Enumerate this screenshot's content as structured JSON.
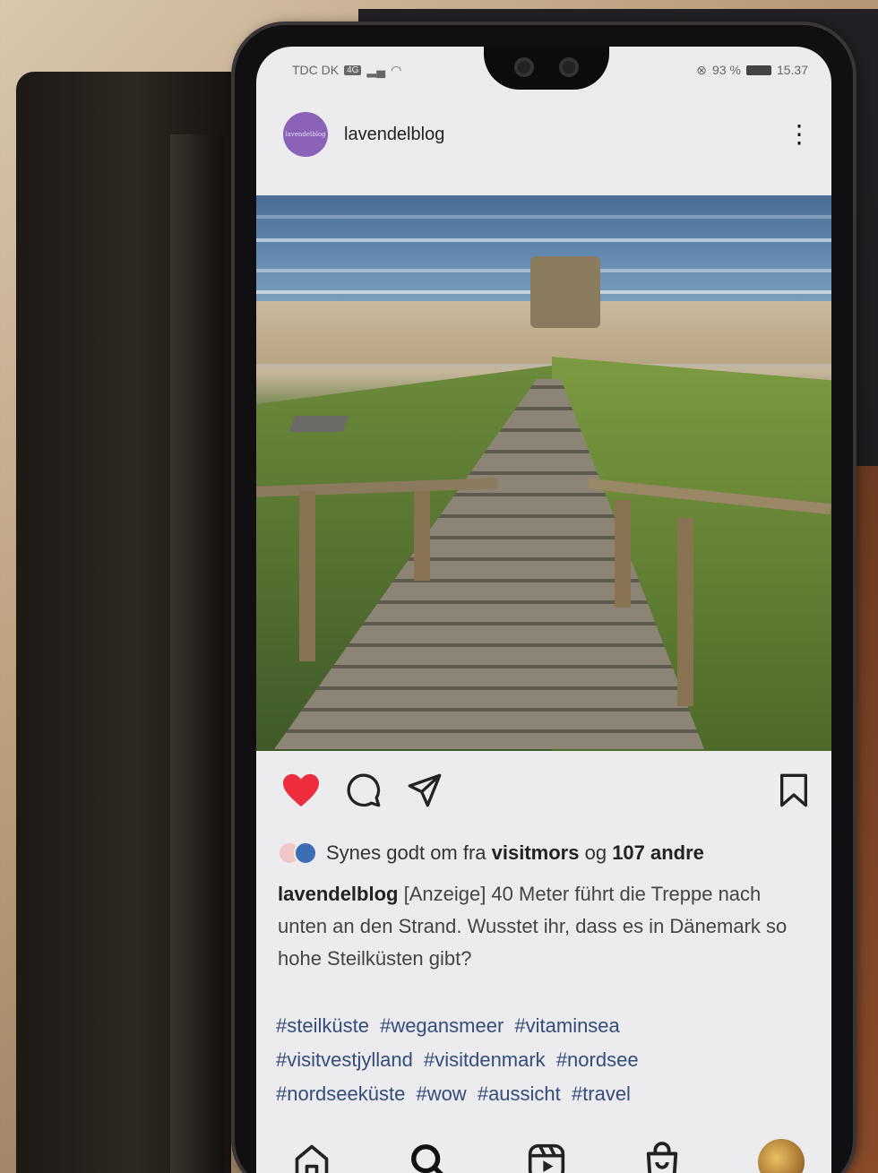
{
  "statusbar": {
    "carrier": "TDC DK",
    "network": "4G",
    "battery_text": "93 %",
    "time": "15.37"
  },
  "post": {
    "username": "lavendelblog",
    "avatar_text": "lavendelblog"
  },
  "likes": {
    "prefix": "Synes godt om fra ",
    "liker": "visitmors",
    "connector": " og ",
    "others": "107 andre"
  },
  "caption": {
    "username": "lavendelblog",
    "text": " [Anzeige] 40 Meter führt die Treppe nach unten an den Strand. Wusstet ihr, dass es in Dänemark so hohe Steilküsten gibt?"
  },
  "hashtags": [
    "#steilküste",
    "#wegansmeer",
    "#vitaminsea",
    "#visitvestjylland",
    "#visitdenmark",
    "#nordsee",
    "#nordseeküste",
    "#wow",
    "#aussicht",
    "#travel"
  ],
  "icons": {
    "like": "heart-icon",
    "comment": "comment-icon",
    "share": "send-icon",
    "save": "bookmark-icon",
    "home": "home-icon",
    "search": "search-icon",
    "reels": "reels-icon",
    "shop": "shop-icon"
  },
  "colors": {
    "like_red": "#ed2c3c",
    "hashtag_blue": "#344c7a",
    "avatar_purple": "#8a63b8"
  }
}
